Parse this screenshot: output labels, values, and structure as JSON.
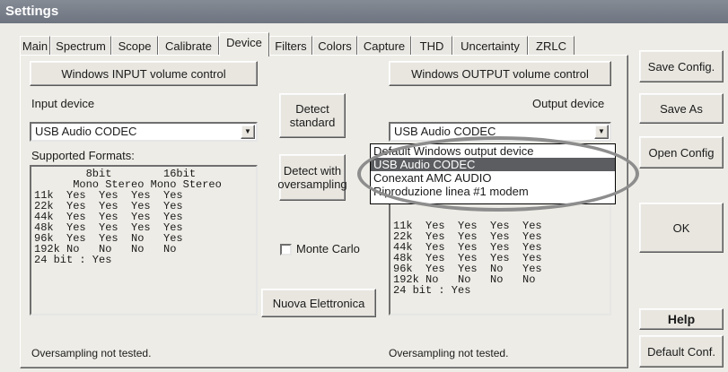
{
  "window": {
    "title": "Settings"
  },
  "tabs": [
    "Main",
    "Spectrum",
    "Scope",
    "Calibrate",
    "Device",
    "Filters",
    "Colors",
    "Capture",
    "THD",
    "Uncertainty",
    "ZRLC"
  ],
  "active_tab": "Device",
  "input": {
    "volume_button": "Windows INPUT volume control",
    "device_label": "Input device",
    "device_value": "USB Audio CODEC",
    "formats_label": "Supported Formats:",
    "table_header1": "        8bit        16bit",
    "table_header2": "      Mono Stereo Mono Stereo",
    "rows": [
      [
        "11k",
        "Yes",
        "Yes",
        "Yes",
        "Yes"
      ],
      [
        "22k",
        "Yes",
        "Yes",
        "Yes",
        "Yes"
      ],
      [
        "44k",
        "Yes",
        "Yes",
        "Yes",
        "Yes"
      ],
      [
        "48k",
        "Yes",
        "Yes",
        "Yes",
        "Yes"
      ],
      [
        "96k",
        "Yes",
        "Yes",
        "No",
        "Yes"
      ],
      [
        "192k",
        "No",
        "No",
        "No",
        "No"
      ]
    ],
    "bit24": "24 bit : Yes",
    "status": "Oversampling not tested."
  },
  "middle": {
    "detect_standard": "Detect standard",
    "detect_oversampling": "Detect with oversampling",
    "monte_carlo": "Monte Carlo",
    "nuova": "Nuova Elettronica"
  },
  "output": {
    "volume_button": "Windows OUTPUT volume control",
    "device_label": "Output device",
    "device_value": "USB Audio CODEC",
    "dropdown_options": [
      "Default Windows output device",
      "USB Audio CODEC",
      "Conexant AMC AUDIO",
      "Riproduzione linea #1 modem"
    ],
    "selected_option": "USB Audio CODEC",
    "rows": [
      [
        "11k",
        "Yes",
        "Yes",
        "Yes",
        "Yes"
      ],
      [
        "22k",
        "Yes",
        "Yes",
        "Yes",
        "Yes"
      ],
      [
        "44k",
        "Yes",
        "Yes",
        "Yes",
        "Yes"
      ],
      [
        "48k",
        "Yes",
        "Yes",
        "Yes",
        "Yes"
      ],
      [
        "96k",
        "Yes",
        "Yes",
        "No",
        "Yes"
      ],
      [
        "192k",
        "No",
        "No",
        "No",
        "No"
      ]
    ],
    "bit24": "24 bit : Yes",
    "status": "Oversampling not tested."
  },
  "right_buttons": {
    "save_config": "Save Config.",
    "save_as": "Save As",
    "open_config": "Open Config",
    "ok": "OK",
    "help": "Help",
    "default_conf": "Default Conf."
  }
}
